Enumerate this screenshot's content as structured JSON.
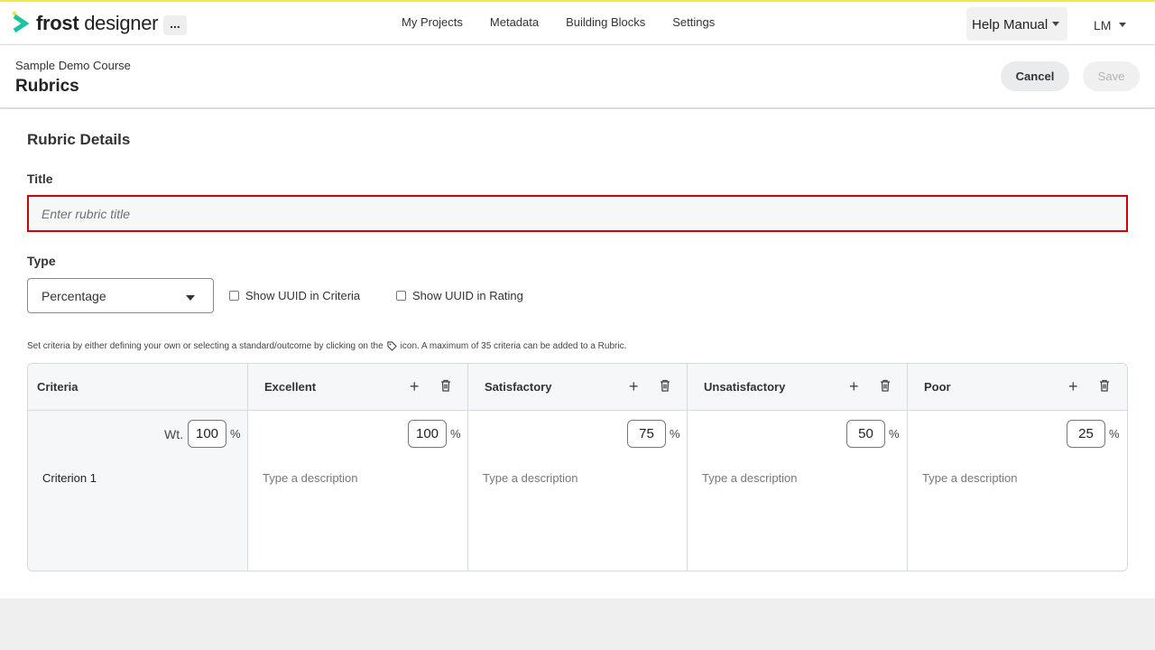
{
  "header": {
    "logo_bold": "frost",
    "logo_light": " designer",
    "more": "...",
    "nav": [
      "My Projects",
      "Metadata",
      "Building Blocks",
      "Settings"
    ],
    "help": "Help Manual",
    "user": "LM",
    "accent_color": "#f2ea4a"
  },
  "subheader": {
    "course": "Sample Demo Course",
    "title": "Rubrics",
    "cancel": "Cancel",
    "save": "Save"
  },
  "form": {
    "section_title": "Rubric Details",
    "title_label": "Title",
    "title_placeholder": "Enter rubric title",
    "title_value": "",
    "type_label": "Type",
    "type_value": "Percentage",
    "show_uuid_criteria": "Show UUID in Criteria",
    "show_uuid_rating": "Show UUID in Rating",
    "hint_before": "Set criteria by either defining your own or selecting a standard/outcome by clicking on the",
    "hint_after": "icon. A maximum of 35 criteria can be added to a Rubric."
  },
  "rubric": {
    "criteria_header": "Criteria",
    "weight_label": "Wt.",
    "weight_value": "100",
    "percent_sign": "%",
    "criterion_name": "Criterion 1",
    "levels": [
      {
        "name": "Excellent",
        "value": "100",
        "description": "Type a description"
      },
      {
        "name": "Satisfactory",
        "value": "75",
        "description": "Type a description"
      },
      {
        "name": "Unsatisfactory",
        "value": "50",
        "description": "Type a description"
      },
      {
        "name": "Poor",
        "value": "25",
        "description": "Type a description"
      }
    ]
  }
}
